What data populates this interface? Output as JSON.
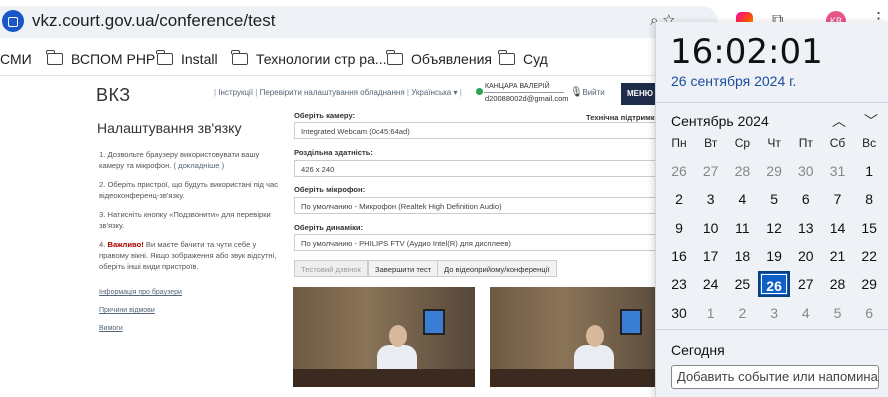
{
  "browser": {
    "url": "vkz.court.gov.ua/conference/test",
    "bookmarks": [
      "СМИ",
      "ВСПОМ PHP",
      "Install",
      "Технологии стр ра...",
      "Объявления",
      "Суд"
    ]
  },
  "site": {
    "logo": "ВКЗ",
    "nav": {
      "instructions": "Інструкції",
      "check_equipment": "Перевірити налаштування обладнання",
      "language": "Українська",
      "logout": "Вийти",
      "menu": "МЕНЮ"
    },
    "user": {
      "name": "КАНЦАРА ВАЛЕРІЙ",
      "email": "d20088002d@gmail.com"
    },
    "title": "Налаштування зв'язку",
    "steps": [
      {
        "num": "1.",
        "text": "Дозвольте браузеру використовувати вашу камеру та мікрофон. (",
        "link": "докладніше",
        "tail": ")"
      },
      {
        "num": "2.",
        "text": "Оберіть пристрої, що будуть використані під час відеоконференц-зв'язку."
      },
      {
        "num": "3.",
        "text": "Натисніть кнопку «Подзвонити» для перевірки зв'язку."
      },
      {
        "num": "4.",
        "bold": "Важливо!",
        "text": " Ви маєте бачити та чути себе у правому вікні. Якщо зображення або звук відсутні, оберіть інші види пристроїв."
      }
    ],
    "side_links": [
      "Інформація про браузери",
      "Причини відмови",
      "Вимоги"
    ],
    "tech_support": "Технічна підтримк",
    "fields": [
      {
        "label": "Оберіть камеру:",
        "value": "Integrated Webcam (0c45:64ad)"
      },
      {
        "label": "Роздільна здатність:",
        "value": "426 x 240"
      },
      {
        "label": "Оберіть мікрофон:",
        "value": "По умолчанию - Микрофон (Realtek High Definition Audio)"
      },
      {
        "label": "Оберіть динаміки:",
        "value": "По умолчанию - PHILIPS FTV (Аудио Intel(R) для дисплеев)"
      }
    ],
    "buttons": {
      "test_call": "Тестовий дзвінок",
      "end_test": "Завершити тест",
      "to_reception": "До відеоприйому/конференції"
    }
  },
  "calendar": {
    "time": "16:02:01",
    "date_long": "26 сентября 2024 г.",
    "month_label": "Сентябрь 2024",
    "weekdays": [
      "Пн",
      "Вт",
      "Ср",
      "Чт",
      "Пт",
      "Сб",
      "Вс"
    ],
    "weeks": [
      [
        "26",
        "27",
        "28",
        "29",
        "30",
        "31",
        "1"
      ],
      [
        "2",
        "3",
        "4",
        "5",
        "6",
        "7",
        "8"
      ],
      [
        "9",
        "10",
        "11",
        "12",
        "13",
        "14",
        "15"
      ],
      [
        "16",
        "17",
        "18",
        "19",
        "20",
        "21",
        "22"
      ],
      [
        "23",
        "24",
        "25",
        "26",
        "27",
        "28",
        "29"
      ],
      [
        "30",
        "1",
        "2",
        "3",
        "4",
        "5",
        "6"
      ]
    ],
    "other_month": [
      [
        0,
        0
      ],
      [
        0,
        1
      ],
      [
        0,
        2
      ],
      [
        0,
        3
      ],
      [
        0,
        4
      ],
      [
        0,
        5
      ],
      [
        5,
        1
      ],
      [
        5,
        2
      ],
      [
        5,
        3
      ],
      [
        5,
        4
      ],
      [
        5,
        5
      ],
      [
        5,
        6
      ]
    ],
    "today": [
      4,
      3
    ],
    "today_title": "Сегодня",
    "event_placeholder": "Добавить событие или напоминание"
  }
}
